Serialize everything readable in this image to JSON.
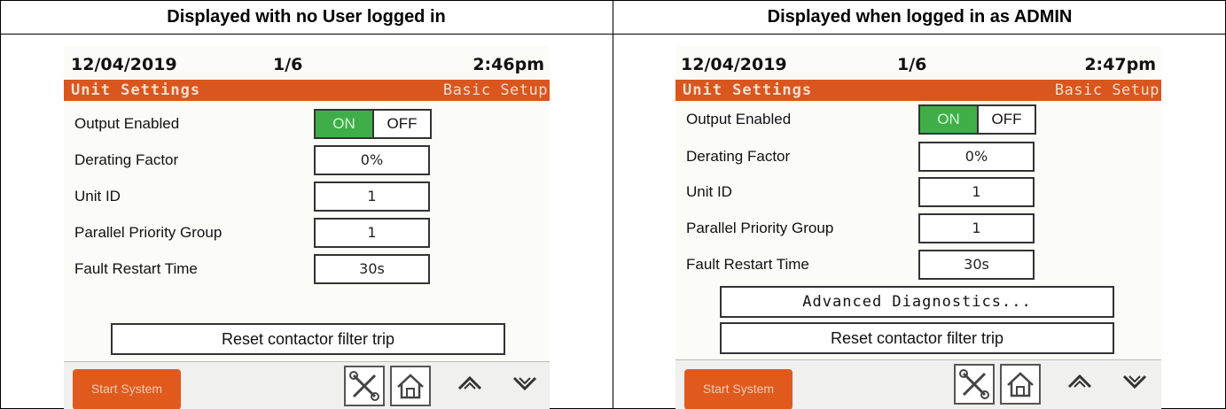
{
  "headers": {
    "left": "Displayed with no User logged in",
    "right": "Displayed when logged in as ADMIN"
  },
  "left_screen": {
    "date": "12/04/2019",
    "page": "1/6",
    "time": "2:46pm",
    "title": "Unit Settings",
    "subtitle": "Basic Setup",
    "output_enabled_label": "Output Enabled",
    "toggle_on": "ON",
    "toggle_off": "OFF",
    "derating_label": "Derating Factor",
    "derating_value": "0%",
    "unit_id_label": "Unit ID",
    "unit_id_value": "1",
    "priority_label": "Parallel Priority Group",
    "priority_value": "1",
    "fault_label": "Fault Restart Time",
    "fault_value": "30s",
    "reset_button": "Reset contactor filter trip",
    "start_button": "Start System"
  },
  "right_screen": {
    "date": "12/04/2019",
    "page": "1/6",
    "time": "2:47pm",
    "title": "Unit Settings",
    "subtitle": "Basic Setup",
    "output_enabled_label": "Output Enabled",
    "toggle_on": "ON",
    "toggle_off": "OFF",
    "derating_label": "Derating Factor",
    "derating_value": "0%",
    "unit_id_label": "Unit ID",
    "unit_id_value": "1",
    "priority_label": "Parallel Priority Group",
    "priority_value": "1",
    "fault_label": "Fault Restart Time",
    "fault_value": "30s",
    "advanced_button": "Advanced Diagnostics...",
    "reset_button": "Reset contactor filter trip",
    "start_button": "Start System"
  },
  "colors": {
    "title_bar": "#d9561e",
    "toggle_on": "#3fae49",
    "start_button": "#e05a1e"
  },
  "icons": [
    "tools-icon",
    "home-icon",
    "chevron-up-icon",
    "chevron-down-icon"
  ]
}
